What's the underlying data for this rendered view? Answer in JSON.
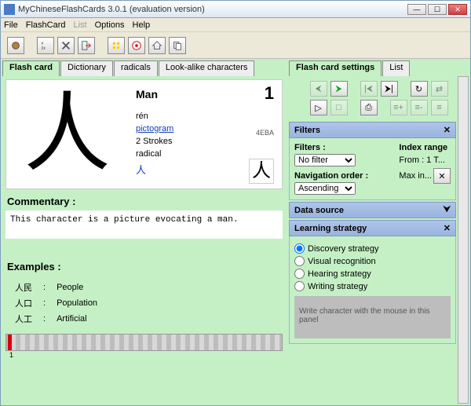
{
  "window": {
    "title": "MyChineseFlashCards 3.0.1  (evaluation version)"
  },
  "menus": [
    "File",
    "FlashCard",
    "List",
    "Options",
    "Help"
  ],
  "menus_disabled": [
    false,
    false,
    true,
    false,
    false
  ],
  "left_tabs": [
    "Flash card",
    "Dictionary",
    "radicals",
    "Look-alike characters"
  ],
  "right_tabs": [
    "Flash card settings",
    "List"
  ],
  "card": {
    "glyph": "人",
    "meaning": "Man",
    "number": "1",
    "pinyin": "rén",
    "etymology_label": "pictogram",
    "unicode": "4EBA",
    "strokes": "2 Strokes",
    "radical_label": "radical",
    "radical_glyph": "人",
    "radical_small": "人"
  },
  "commentary": {
    "header": "Commentary :",
    "text": "This character is a picture evocating a man."
  },
  "examples": {
    "header": "Examples :",
    "rows": [
      {
        "glyph": "人民",
        "sep": ":",
        "meaning": "People"
      },
      {
        "glyph": "人口",
        "sep": ":",
        "meaning": "Population"
      },
      {
        "glyph": "人工",
        "sep": ":",
        "meaning": "Artificial"
      }
    ]
  },
  "progress": {
    "current": "1"
  },
  "filters": {
    "title": "Filters",
    "filters_label": "Filters :",
    "filter_value": "No filter",
    "nav_label": "Navigation order :",
    "nav_value": "Ascending",
    "range_label": "Index range",
    "from_label": "From :",
    "from_value": "1",
    "to_label": "T...",
    "maxin_label": "Max in..."
  },
  "datasource": {
    "title": "Data source"
  },
  "learning": {
    "title": "Learning strategy",
    "options": [
      "Discovery strategy",
      "Visual recognition",
      "Hearing strategy",
      "Writing strategy"
    ],
    "selected": 0,
    "drawhint": "Write character with the mouse in this panel"
  }
}
